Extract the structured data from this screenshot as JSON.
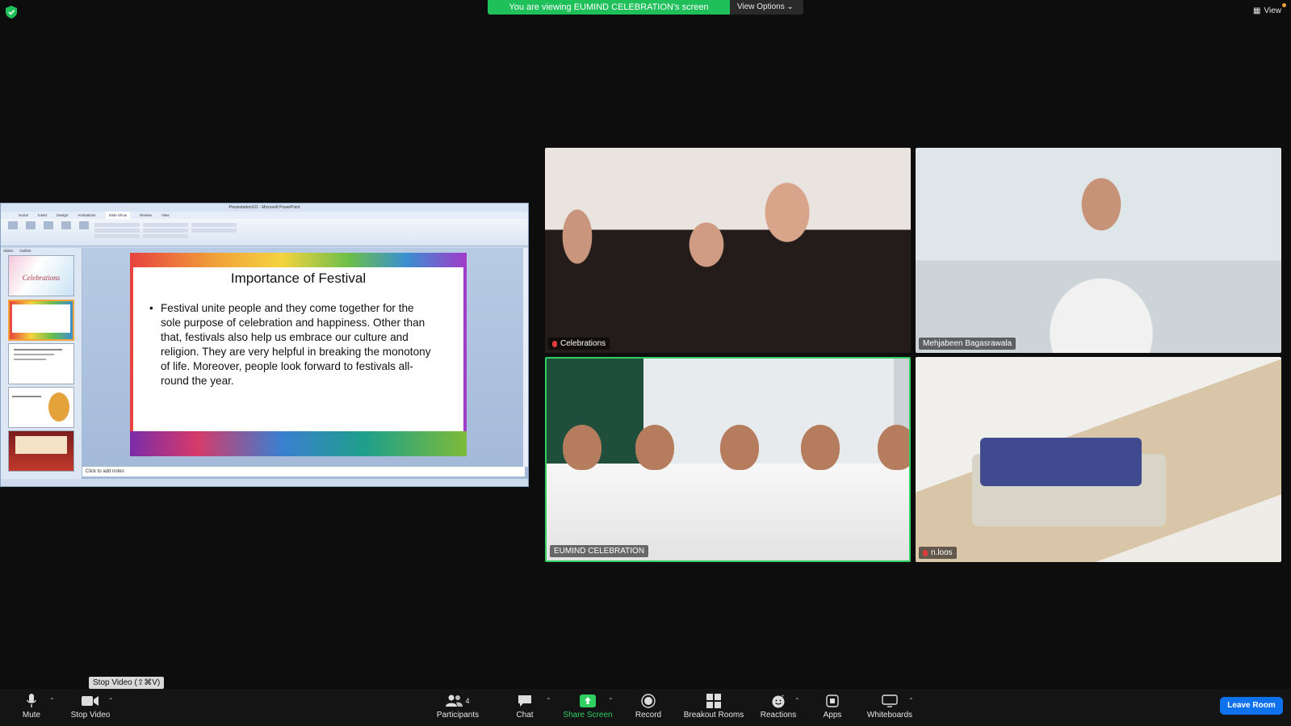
{
  "top": {
    "banner_text": "You are viewing EUMIND CELEBRATION's screen",
    "view_options": "View Options",
    "view": "View"
  },
  "ppt": {
    "window_title": "Presentation101 - Microsoft PowerPoint",
    "tabs": [
      "Home",
      "Insert",
      "Design",
      "Animations",
      "Slide Show",
      "Review",
      "View"
    ],
    "side_tabs": [
      "Slides",
      "Outline"
    ],
    "thumb1_text": "Celebrations",
    "slide_title": "Importance of Festival",
    "slide_body": "Festival unite people and they come together for the sole purpose of celebration and happiness. Other than that, festivals also help us embrace our culture and religion. They are very helpful in breaking the monotony of life. Moreover, people look forward to festivals all-round the year.",
    "notes": "Click to add notes"
  },
  "tiles": [
    {
      "name": "Celebrations"
    },
    {
      "name": "Mehjabeen Bagasrawala"
    },
    {
      "name": "EUMIND CELEBRATION"
    },
    {
      "name": "n.loos"
    }
  ],
  "tooltip": "Stop Video (⇧⌘V)",
  "toolbar": {
    "mute": "Mute",
    "stop_video": "Stop Video",
    "participants": "Participants",
    "participants_count": "4",
    "chat": "Chat",
    "share_screen": "Share Screen",
    "record": "Record",
    "breakout": "Breakout Rooms",
    "reactions": "Reactions",
    "apps": "Apps",
    "whiteboards": "Whiteboards",
    "leave": "Leave Room"
  }
}
